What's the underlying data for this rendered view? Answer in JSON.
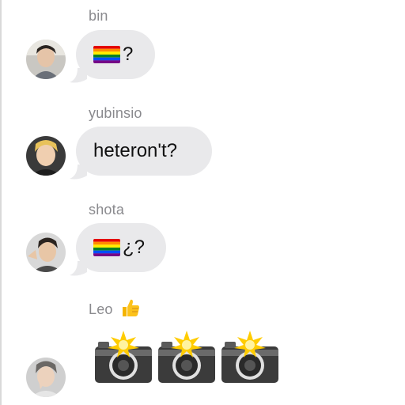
{
  "messages": [
    {
      "sender": "bin",
      "text": "?",
      "emoji": "rainbow-flag-icon"
    },
    {
      "sender": "yubinsio",
      "text": "heteron't?"
    },
    {
      "sender": "shota",
      "text": "¿?",
      "emoji": "rainbow-flag-icon"
    },
    {
      "sender": "Leo",
      "sender_emoji": "thumbs-up-icon",
      "attachments": [
        "camera-with-flash-icon",
        "camera-with-flash-icon",
        "camera-with-flash-icon"
      ]
    }
  ],
  "colors": {
    "bubble": "#e9e9eb",
    "sender_name": "#8a8a8e",
    "text": "#111111"
  }
}
